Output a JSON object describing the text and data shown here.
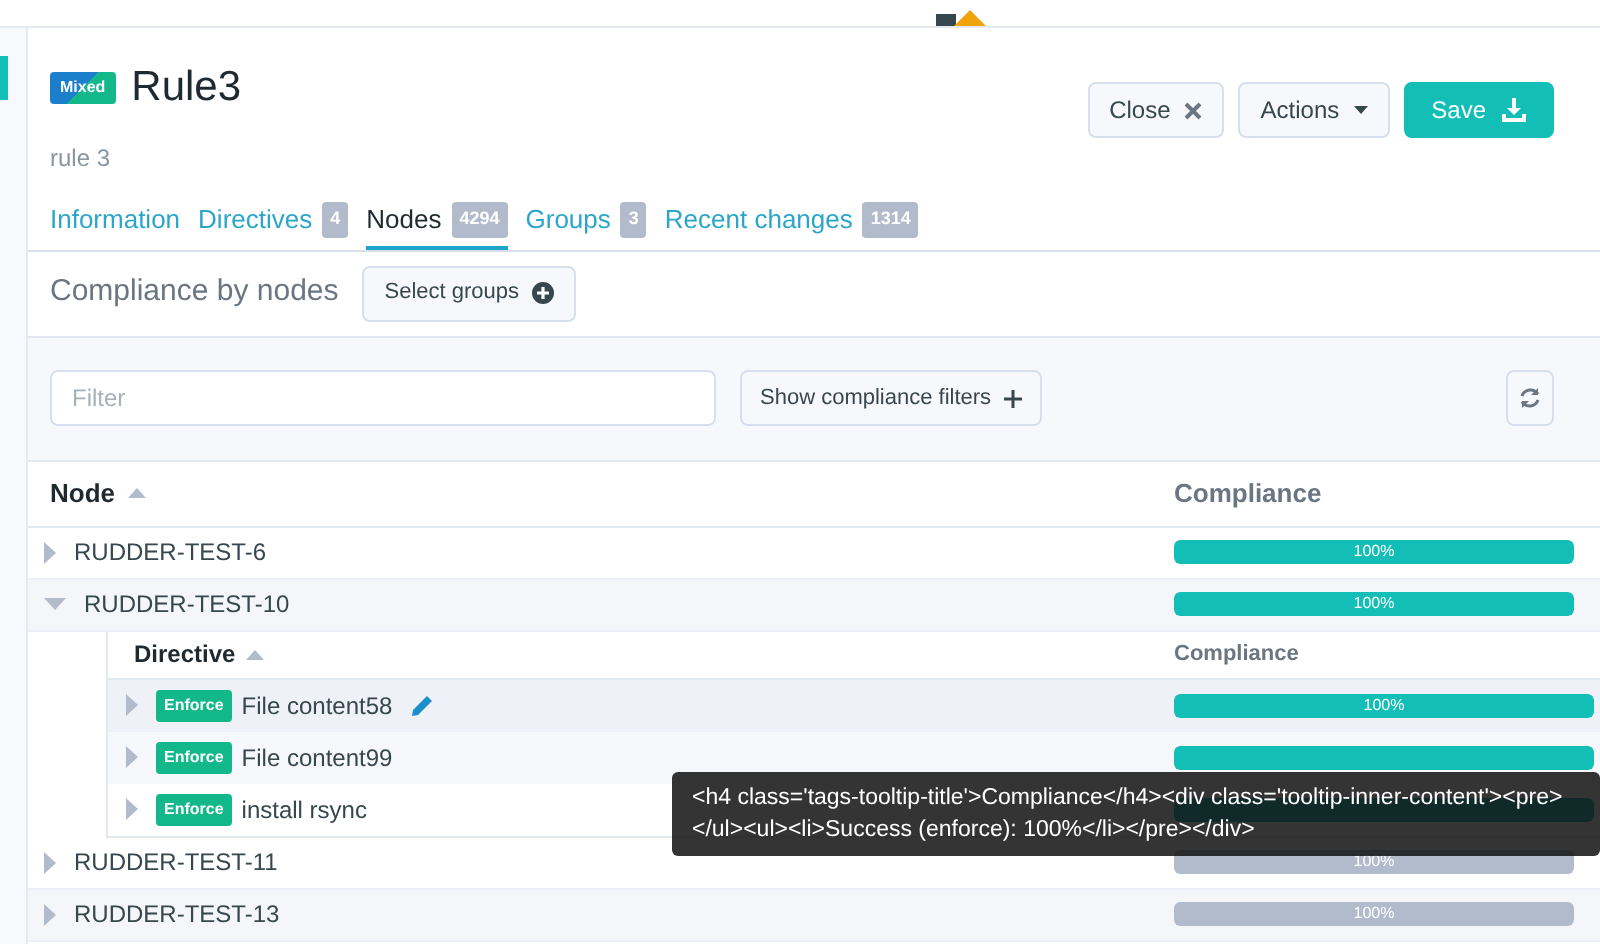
{
  "rule": {
    "badge": "Mixed",
    "title": "Rule3",
    "description": "rule 3"
  },
  "header_buttons": [
    {
      "kind": "close",
      "label": "Close"
    },
    {
      "kind": "dropdown",
      "label": "Actions"
    },
    {
      "kind": "save",
      "label": "Save"
    }
  ],
  "tabs": [
    {
      "label": "Information",
      "selected": false
    },
    {
      "label": "Directives",
      "count": "4",
      "selected": false
    },
    {
      "label": "Nodes",
      "count": "4294",
      "selected": true
    },
    {
      "label": "Groups",
      "count": "3",
      "selected": false
    },
    {
      "label": "Recent changes",
      "count": "1314",
      "selected": false
    }
  ],
  "section": {
    "title": "Compliance by nodes",
    "select_button": "Select groups"
  },
  "filter": {
    "placeholder": "Filter",
    "filters_button": "Show compliance filters"
  },
  "table": {
    "columns": [
      "Node",
      "Compliance"
    ],
    "rows": [
      {
        "node": "RUDDER-TEST-6",
        "expanded": false,
        "compliance": "100%",
        "level": 1,
        "color": "#13beb7"
      },
      {
        "node": "RUDDER-TEST-10",
        "expanded": true,
        "compliance": "100%",
        "level": 1,
        "color": "#13beb7",
        "sub_table": {
          "columns": [
            "Directive",
            "Compliance"
          ],
          "rows": [
            {
              "badge": "Enforce",
              "directive": "File content58",
              "editable": true,
              "compliance": "100%",
              "level": 1
            },
            {
              "badge": "Enforce",
              "directive": "File content99",
              "editable": false,
              "level": 1
            },
            {
              "badge": "Enforce",
              "directive": "install rsync",
              "editable": false,
              "level": 1
            }
          ]
        }
      },
      {
        "node": "RUDDER-TEST-11",
        "expanded": false,
        "compliance": "100%",
        "level": 1,
        "color": "#b1bbcb"
      },
      {
        "node": "RUDDER-TEST-13",
        "expanded": false,
        "compliance": "100%",
        "level": 1,
        "color": "#b1bbcb"
      }
    ]
  },
  "tooltip": {
    "text": "<h4 class='tags-tooltip-title'>Compliance</h4><div class='tooltip-inner-content'><pre></ul><ul><li>Success (enforce): 100%</li></pre></div>"
  }
}
